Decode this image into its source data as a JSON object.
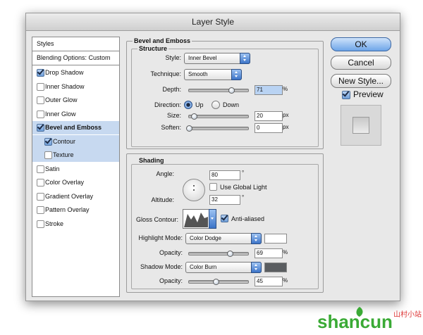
{
  "window": {
    "title": "Layer Style"
  },
  "styles_panel": {
    "header": "Styles",
    "blending": "Blending Options: Custom",
    "items": [
      {
        "label": "Drop Shadow",
        "checked": true
      },
      {
        "label": "Inner Shadow",
        "checked": false
      },
      {
        "label": "Outer Glow",
        "checked": false
      },
      {
        "label": "Inner Glow",
        "checked": false
      },
      {
        "label": "Bevel and Emboss",
        "checked": true,
        "selected": true
      },
      {
        "label": "Contour",
        "checked": true,
        "sub": true
      },
      {
        "label": "Texture",
        "checked": false,
        "sub": true
      },
      {
        "label": "Satin",
        "checked": false
      },
      {
        "label": "Color Overlay",
        "checked": false
      },
      {
        "label": "Gradient Overlay",
        "checked": false
      },
      {
        "label": "Pattern Overlay",
        "checked": false
      },
      {
        "label": "Stroke",
        "checked": false
      }
    ]
  },
  "bevel": {
    "group_title": "Bevel and Emboss",
    "structure_title": "Structure",
    "style_label": "Style:",
    "style_value": "Inner Bevel",
    "technique_label": "Technique:",
    "technique_value": "Smooth",
    "depth_label": "Depth:",
    "depth_value": "71",
    "depth_unit": "%",
    "depth_level": 71,
    "direction_label": "Direction:",
    "dir_up": "Up",
    "dir_down": "Down",
    "size_label": "Size:",
    "size_value": "20",
    "size_unit": "px",
    "size_level": 8,
    "soften_label": "Soften:",
    "soften_value": "0",
    "soften_unit": "px",
    "soften_level": 0
  },
  "shading": {
    "title": "Shading",
    "angle_label": "Angle:",
    "angle_value": "80",
    "angle_unit": "°",
    "global_light": "Use Global Light",
    "altitude_label": "Altitude:",
    "altitude_value": "32",
    "altitude_unit": "°",
    "gloss_label": "Gloss Contour:",
    "anti_aliased": "Anti-aliased",
    "highlight_label": "Highlight Mode:",
    "highlight_value": "Color Dodge",
    "highlight_color": "#ffffff",
    "hl_opacity_label": "Opacity:",
    "hl_opacity_value": "69",
    "hl_opacity_unit": "%",
    "hl_opacity_level": 69,
    "shadow_label": "Shadow Mode:",
    "shadow_value": "Color Burn",
    "shadow_color": "#5a5d60",
    "sh_opacity_label": "Opacity:",
    "sh_opacity_value": "45",
    "sh_opacity_unit": "%",
    "sh_opacity_level": 45
  },
  "buttons": {
    "ok": "OK",
    "cancel": "Cancel",
    "new_style": "New Style...",
    "preview": "Preview"
  },
  "watermark": {
    "brand": "shancun",
    "subtitle": "山村小站",
    "brand_color": "#3aaa35"
  }
}
